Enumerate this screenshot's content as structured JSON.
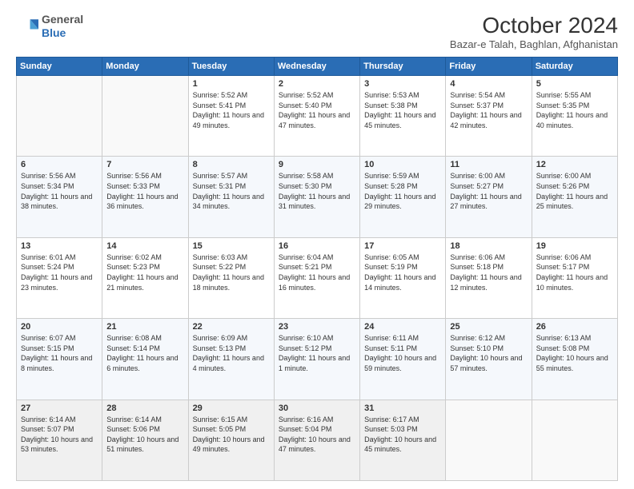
{
  "logo": {
    "general": "General",
    "blue": "Blue"
  },
  "header": {
    "month": "October 2024",
    "location": "Bazar-e Talah, Baghlan, Afghanistan"
  },
  "weekdays": [
    "Sunday",
    "Monday",
    "Tuesday",
    "Wednesday",
    "Thursday",
    "Friday",
    "Saturday"
  ],
  "weeks": [
    [
      {
        "day": "",
        "content": ""
      },
      {
        "day": "",
        "content": ""
      },
      {
        "day": "1",
        "content": "Sunrise: 5:52 AM\nSunset: 5:41 PM\nDaylight: 11 hours and 49 minutes."
      },
      {
        "day": "2",
        "content": "Sunrise: 5:52 AM\nSunset: 5:40 PM\nDaylight: 11 hours and 47 minutes."
      },
      {
        "day": "3",
        "content": "Sunrise: 5:53 AM\nSunset: 5:38 PM\nDaylight: 11 hours and 45 minutes."
      },
      {
        "day": "4",
        "content": "Sunrise: 5:54 AM\nSunset: 5:37 PM\nDaylight: 11 hours and 42 minutes."
      },
      {
        "day": "5",
        "content": "Sunrise: 5:55 AM\nSunset: 5:35 PM\nDaylight: 11 hours and 40 minutes."
      }
    ],
    [
      {
        "day": "6",
        "content": "Sunrise: 5:56 AM\nSunset: 5:34 PM\nDaylight: 11 hours and 38 minutes."
      },
      {
        "day": "7",
        "content": "Sunrise: 5:56 AM\nSunset: 5:33 PM\nDaylight: 11 hours and 36 minutes."
      },
      {
        "day": "8",
        "content": "Sunrise: 5:57 AM\nSunset: 5:31 PM\nDaylight: 11 hours and 34 minutes."
      },
      {
        "day": "9",
        "content": "Sunrise: 5:58 AM\nSunset: 5:30 PM\nDaylight: 11 hours and 31 minutes."
      },
      {
        "day": "10",
        "content": "Sunrise: 5:59 AM\nSunset: 5:28 PM\nDaylight: 11 hours and 29 minutes."
      },
      {
        "day": "11",
        "content": "Sunrise: 6:00 AM\nSunset: 5:27 PM\nDaylight: 11 hours and 27 minutes."
      },
      {
        "day": "12",
        "content": "Sunrise: 6:00 AM\nSunset: 5:26 PM\nDaylight: 11 hours and 25 minutes."
      }
    ],
    [
      {
        "day": "13",
        "content": "Sunrise: 6:01 AM\nSunset: 5:24 PM\nDaylight: 11 hours and 23 minutes."
      },
      {
        "day": "14",
        "content": "Sunrise: 6:02 AM\nSunset: 5:23 PM\nDaylight: 11 hours and 21 minutes."
      },
      {
        "day": "15",
        "content": "Sunrise: 6:03 AM\nSunset: 5:22 PM\nDaylight: 11 hours and 18 minutes."
      },
      {
        "day": "16",
        "content": "Sunrise: 6:04 AM\nSunset: 5:21 PM\nDaylight: 11 hours and 16 minutes."
      },
      {
        "day": "17",
        "content": "Sunrise: 6:05 AM\nSunset: 5:19 PM\nDaylight: 11 hours and 14 minutes."
      },
      {
        "day": "18",
        "content": "Sunrise: 6:06 AM\nSunset: 5:18 PM\nDaylight: 11 hours and 12 minutes."
      },
      {
        "day": "19",
        "content": "Sunrise: 6:06 AM\nSunset: 5:17 PM\nDaylight: 11 hours and 10 minutes."
      }
    ],
    [
      {
        "day": "20",
        "content": "Sunrise: 6:07 AM\nSunset: 5:15 PM\nDaylight: 11 hours and 8 minutes."
      },
      {
        "day": "21",
        "content": "Sunrise: 6:08 AM\nSunset: 5:14 PM\nDaylight: 11 hours and 6 minutes."
      },
      {
        "day": "22",
        "content": "Sunrise: 6:09 AM\nSunset: 5:13 PM\nDaylight: 11 hours and 4 minutes."
      },
      {
        "day": "23",
        "content": "Sunrise: 6:10 AM\nSunset: 5:12 PM\nDaylight: 11 hours and 1 minute."
      },
      {
        "day": "24",
        "content": "Sunrise: 6:11 AM\nSunset: 5:11 PM\nDaylight: 10 hours and 59 minutes."
      },
      {
        "day": "25",
        "content": "Sunrise: 6:12 AM\nSunset: 5:10 PM\nDaylight: 10 hours and 57 minutes."
      },
      {
        "day": "26",
        "content": "Sunrise: 6:13 AM\nSunset: 5:08 PM\nDaylight: 10 hours and 55 minutes."
      }
    ],
    [
      {
        "day": "27",
        "content": "Sunrise: 6:14 AM\nSunset: 5:07 PM\nDaylight: 10 hours and 53 minutes."
      },
      {
        "day": "28",
        "content": "Sunrise: 6:14 AM\nSunset: 5:06 PM\nDaylight: 10 hours and 51 minutes."
      },
      {
        "day": "29",
        "content": "Sunrise: 6:15 AM\nSunset: 5:05 PM\nDaylight: 10 hours and 49 minutes."
      },
      {
        "day": "30",
        "content": "Sunrise: 6:16 AM\nSunset: 5:04 PM\nDaylight: 10 hours and 47 minutes."
      },
      {
        "day": "31",
        "content": "Sunrise: 6:17 AM\nSunset: 5:03 PM\nDaylight: 10 hours and 45 minutes."
      },
      {
        "day": "",
        "content": ""
      },
      {
        "day": "",
        "content": ""
      }
    ]
  ]
}
